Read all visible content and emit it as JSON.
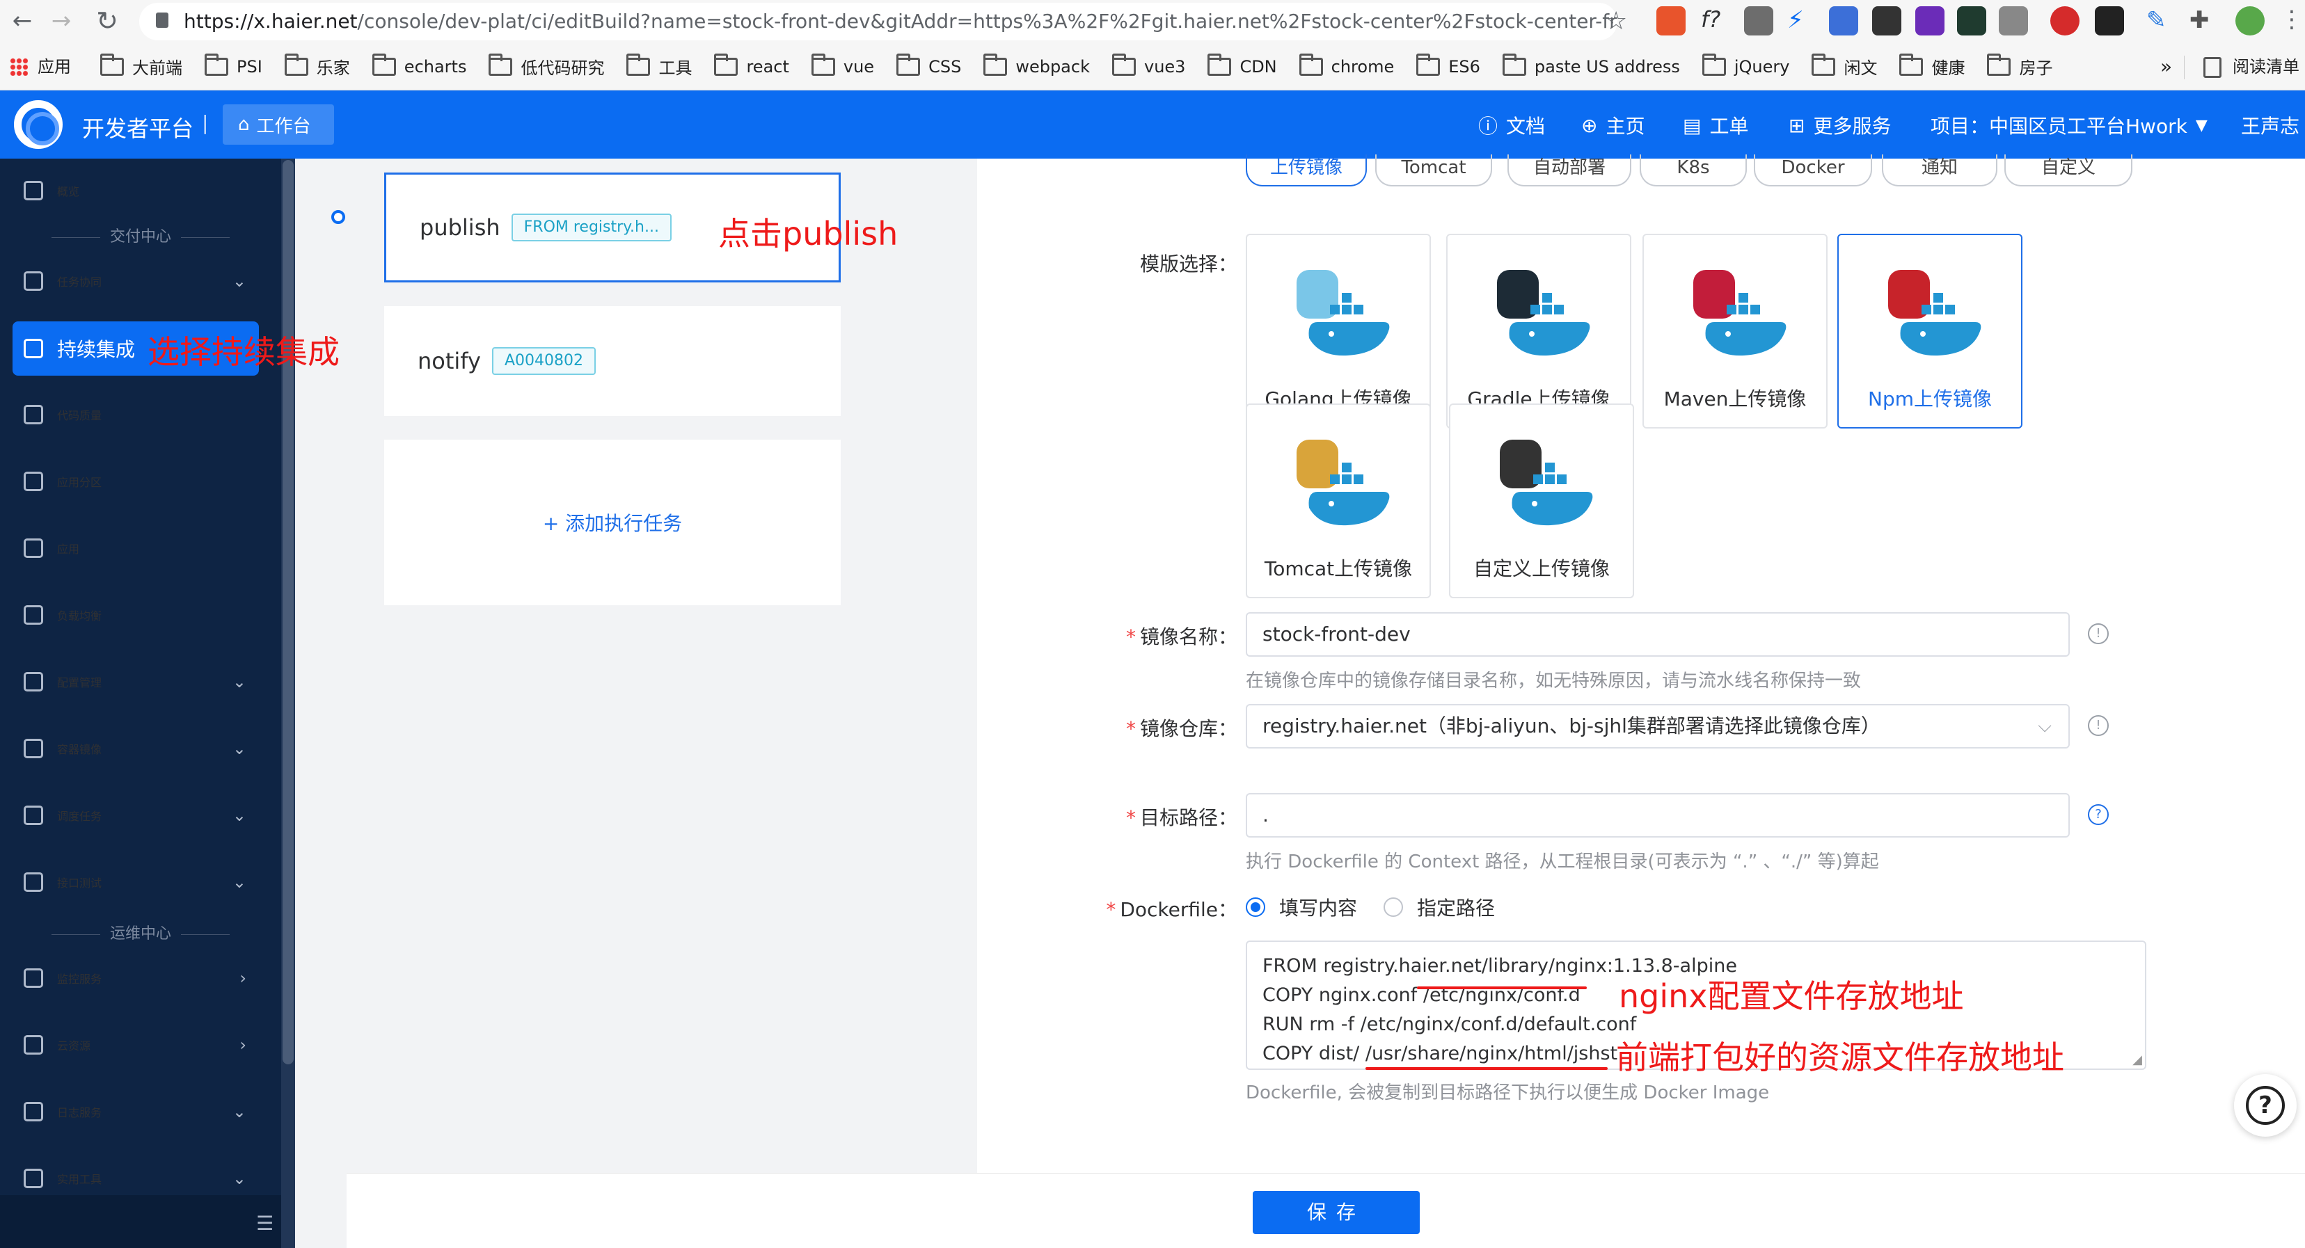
{
  "browser": {
    "url_host": "https://x.haier.net",
    "url_path": "/console/dev-plat/ci/editBuild?name=stock-front-dev&gitAddr=https%3A%2F%2Fgit.haier.net%2Fstock-center%2Fstock-center-front.gi...",
    "bookmarks": [
      "应用",
      "大前端",
      "PSI",
      "乐家",
      "echarts",
      "低代码研究",
      "工具",
      "react",
      "vue",
      "CSS",
      "webpack",
      "vue3",
      "CDN",
      "chrome",
      "ES6",
      "paste US address",
      "jQuery",
      "闲文",
      "健康",
      "房子"
    ],
    "more": "»",
    "reading_list": "阅读清单"
  },
  "header": {
    "title": "开发者平台",
    "separator": "|",
    "workbench": "工作台",
    "docs": "文档",
    "home": "主页",
    "tickets": "工单",
    "more_services": "更多服务",
    "project": "项目：中国区员工平台Hwork",
    "user": "王声志"
  },
  "sidebar": {
    "overview": "概览",
    "group_delivery": "交付中心",
    "task_collab": "任务协同",
    "ci": "持续集成",
    "code_quality": "代码质量",
    "app_partition": "应用分区",
    "app": "应用",
    "load_balance": "负载均衡",
    "config_mgmt": "配置管理",
    "container_image": "容器镜像",
    "schedule_task": "调度任务",
    "api_test": "接口测试",
    "group_ops": "运维中心",
    "monitor": "监控服务",
    "cloud": "云资源",
    "log_service": "日志服务",
    "tools": "实用工具"
  },
  "tasks": {
    "publish_name": "publish",
    "publish_tag": "FROM registry.h...",
    "notify_name": "notify",
    "notify_tag": "A0040802",
    "add_task": "+ 添加执行任务"
  },
  "annotations": {
    "select_ci": "选择持续集成",
    "click_publish": "点击publish",
    "nginx_conf": "nginx配置文件存放地址",
    "frontend_dist": "前端打包好的资源文件存放地址"
  },
  "tabs": [
    "上传镜像",
    "Tomcat",
    "自动部署",
    "K8s",
    "Docker",
    "通知",
    "自定义"
  ],
  "form": {
    "template_label": "模版选择：",
    "templates": [
      "Golang上传镜像",
      "Gradle上传镜像",
      "Maven上传镜像",
      "Npm上传镜像",
      "Tomcat上传镜像",
      "自定义上传镜像"
    ],
    "image_name_label": "镜像名称：",
    "image_name_value": "stock-front-dev",
    "image_name_hint": "在镜像仓库中的镜像存储目录名称，如无特殊原因，请与流水线名称保持一致",
    "registry_label": "镜像仓库：",
    "registry_value": "registry.haier.net（非bj-aliyun、bj-sjhl集群部署请选择此镜像仓库）",
    "target_label": "目标路径：",
    "target_value": ".",
    "target_hint": "执行 Dockerfile 的 Context 路径，从工程根目录(可表示为 “.” 、“./” 等)算起",
    "dockerfile_label": "Dockerfile：",
    "radio_fill": "填写内容",
    "radio_path": "指定路径",
    "dockerfile_lines": [
      "FROM registry.haier.net/library/nginx:1.13.8-alpine",
      "COPY nginx.conf /etc/nginx/conf.d",
      "RUN rm -f /etc/nginx/conf.d/default.conf",
      "COPY dist/ /usr/share/nginx/html/jshst"
    ],
    "dockerfile_hint": "Dockerfile, 会被复制到目标路径下执行以便生成 Docker Image",
    "required_mark": "*"
  },
  "footer": {
    "save": "保存"
  },
  "colors": {
    "primary": "#0b6cf2",
    "sidebar": "#0e2444",
    "annotation": "#ee1a1a"
  }
}
